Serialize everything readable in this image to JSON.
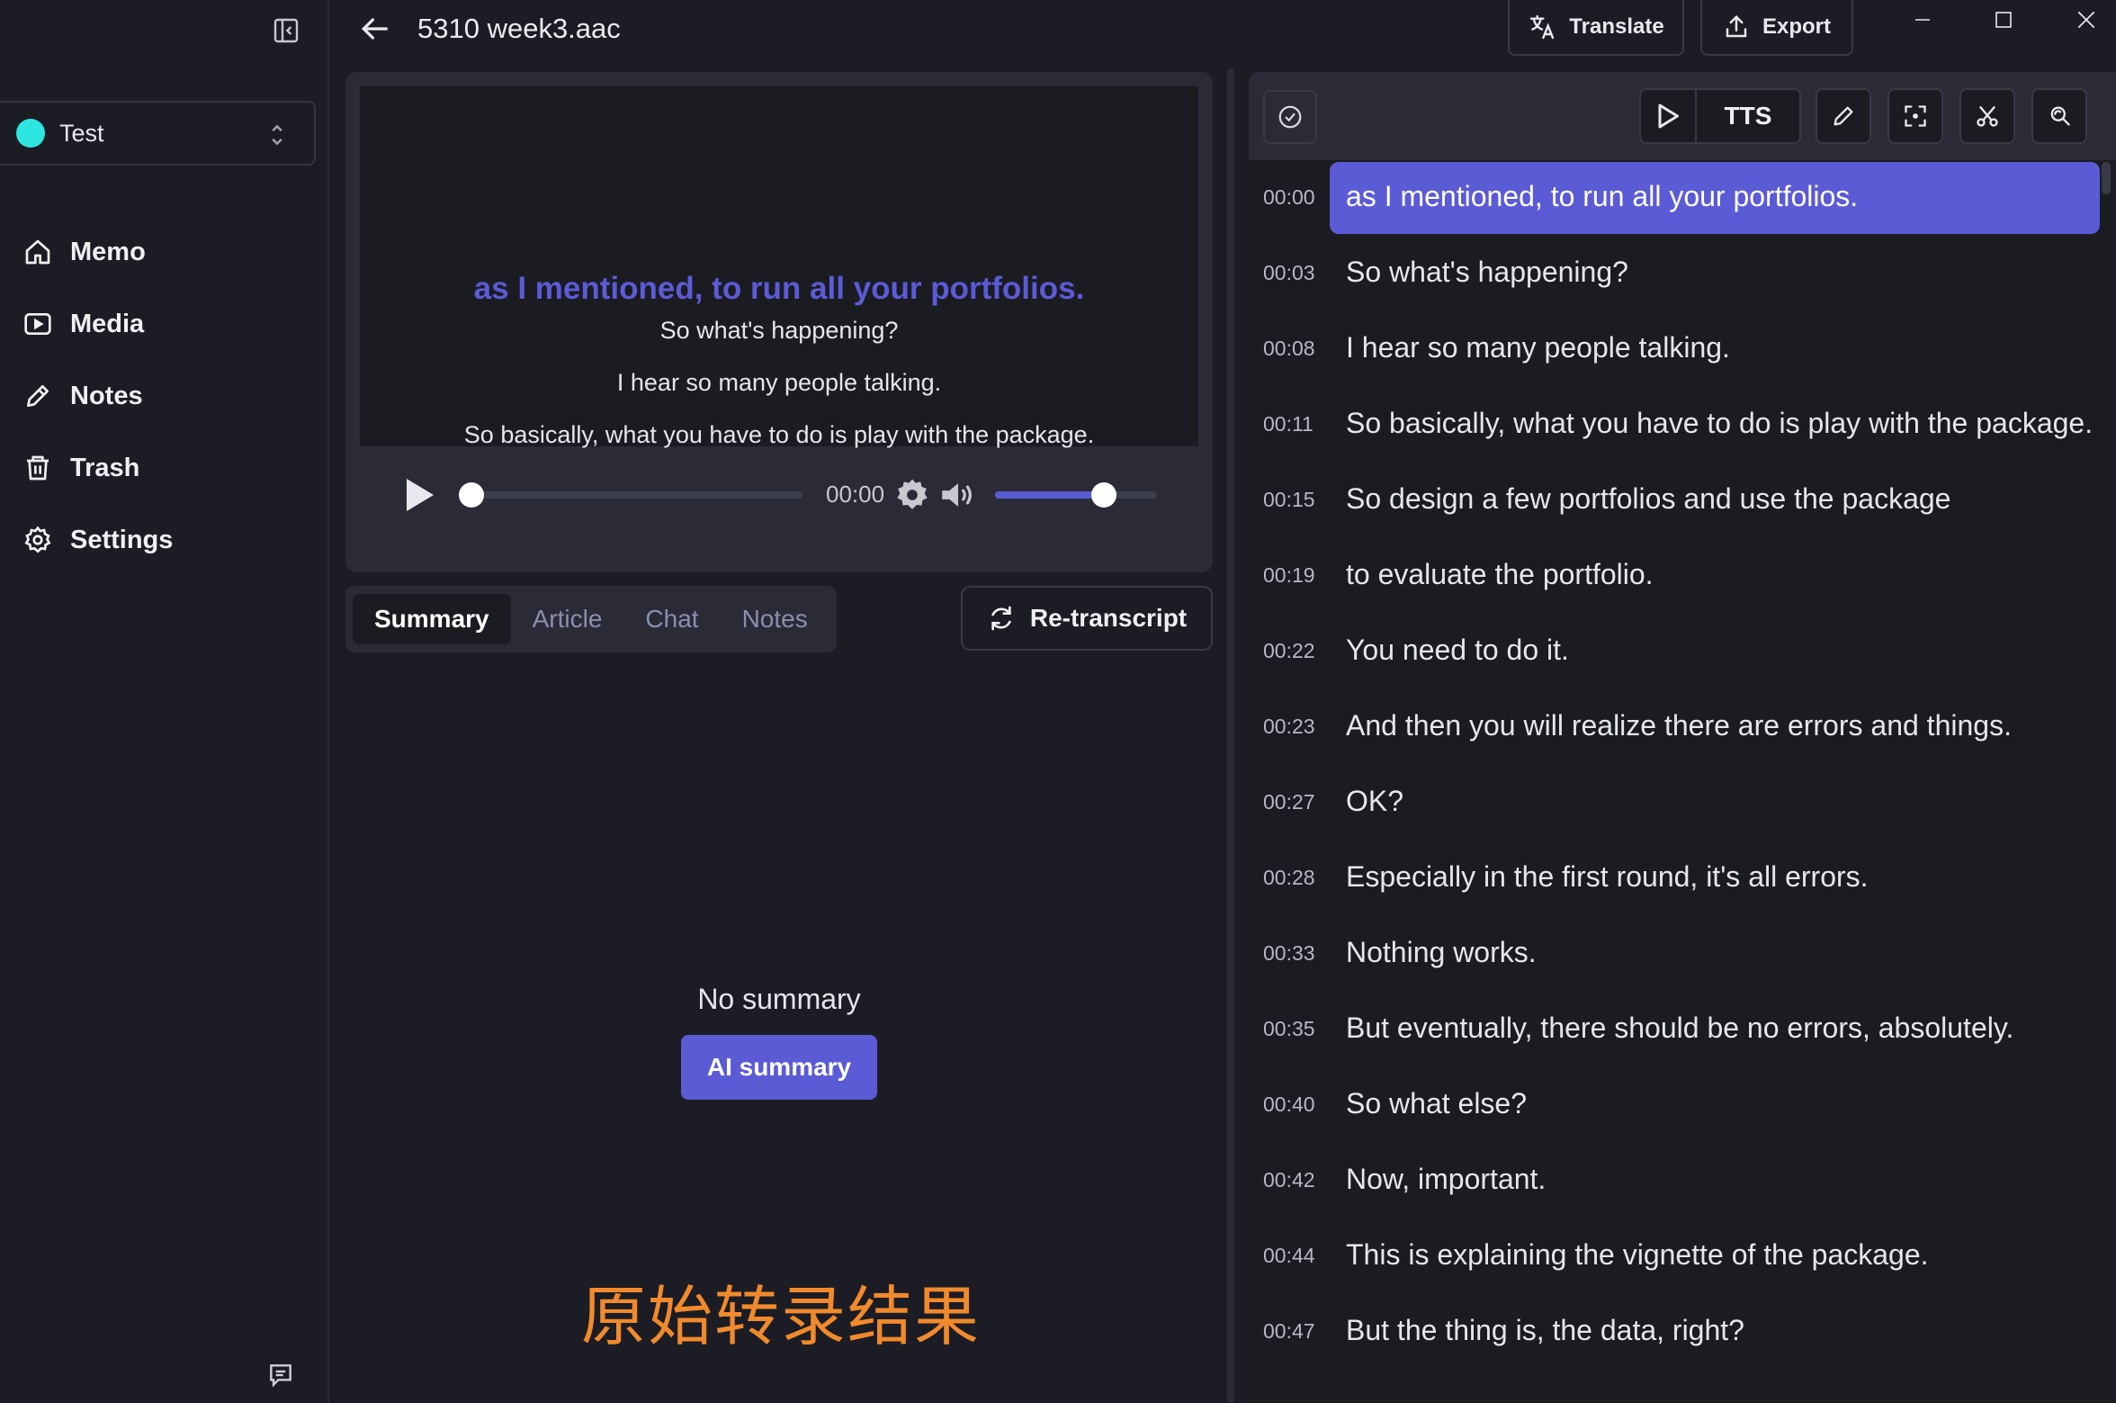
{
  "sidebar": {
    "workspace": {
      "name": "Test",
      "dot_color": "#2ee6e0"
    },
    "items": [
      {
        "label": "Memo",
        "icon": "home-icon"
      },
      {
        "label": "Media",
        "icon": "media-icon"
      },
      {
        "label": "Notes",
        "icon": "pencil-icon"
      },
      {
        "label": "Trash",
        "icon": "trash-icon"
      },
      {
        "label": "Settings",
        "icon": "gear-icon"
      }
    ]
  },
  "header": {
    "file_name": "5310 week3.aac",
    "translate_label": "Translate",
    "export_label": "Export"
  },
  "player": {
    "subtitles": {
      "active": "as I mentioned, to run all your portfolios.",
      "next": [
        "So what's happening?",
        "I hear so many people talking.",
        "So basically, what you have to do is play with the package."
      ]
    },
    "time": "00:00",
    "progress": 0,
    "volume": 0.67
  },
  "tabs": {
    "items": [
      "Summary",
      "Article",
      "Chat",
      "Notes"
    ],
    "active": "Summary"
  },
  "retranscript_label": "Re-transcript",
  "summary": {
    "empty_text": "No summary",
    "button_label": "AI summary"
  },
  "watermark_text": "原始转录结果",
  "transcript_toolbar": {
    "tts_label": "TTS"
  },
  "transcript": [
    {
      "time": "00:00",
      "text": "as I mentioned, to run all your portfolios.",
      "active": true
    },
    {
      "time": "00:03",
      "text": "So what's happening?"
    },
    {
      "time": "00:08",
      "text": "I hear so many people talking."
    },
    {
      "time": "00:11",
      "text": "So basically, what you have to do is play with the package."
    },
    {
      "time": "00:15",
      "text": "So design a few portfolios and use the package"
    },
    {
      "time": "00:19",
      "text": "to evaluate the portfolio."
    },
    {
      "time": "00:22",
      "text": "You need to do it."
    },
    {
      "time": "00:23",
      "text": "And then you will realize there are errors and things."
    },
    {
      "time": "00:27",
      "text": "OK?"
    },
    {
      "time": "00:28",
      "text": "Especially in the first round, it's all errors."
    },
    {
      "time": "00:33",
      "text": "Nothing works."
    },
    {
      "time": "00:35",
      "text": "But eventually, there should be no errors, absolutely."
    },
    {
      "time": "00:40",
      "text": "So what else?"
    },
    {
      "time": "00:42",
      "text": "Now, important."
    },
    {
      "time": "00:44",
      "text": "This is explaining the vignette of the package."
    },
    {
      "time": "00:47",
      "text": "But the thing is, the data, right?"
    }
  ],
  "colors": {
    "accent": "#5b5bd6",
    "background": "#1c1c24",
    "panel": "#2a2b36",
    "watermark": "#f08a2c"
  }
}
